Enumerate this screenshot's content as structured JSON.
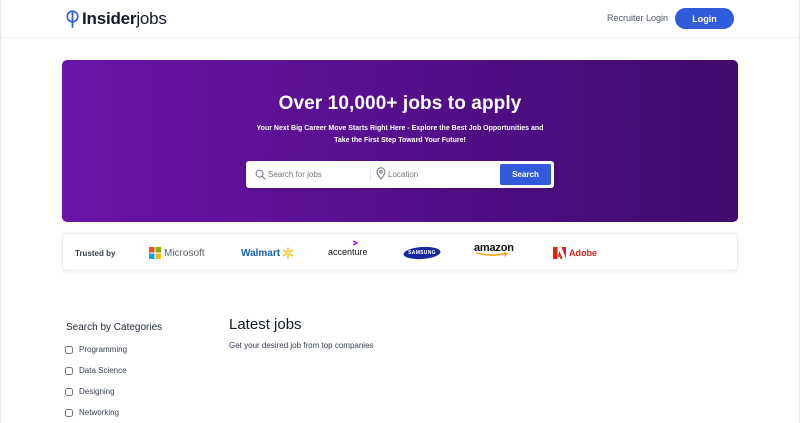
{
  "header": {
    "logo_prefix": "Insider",
    "logo_suffix": "jobs",
    "recruiter_login": "Recruiter Login",
    "login": "Login"
  },
  "hero": {
    "title": "Over 10,000+ jobs to apply",
    "subtitle_line1": "Your Next Big Career Move Starts Right Here - Explore the Best Job Opportunities and",
    "subtitle_line2": "Take the First Step Toward Your Future!",
    "search_placeholder": "Search for jobs",
    "location_placeholder": "Location",
    "search_button": "Search"
  },
  "trusted": {
    "label": "Trusted by",
    "brands": [
      "Microsoft",
      "Walmart",
      "accenture",
      "SAMSUNG",
      "amazon",
      "Adobe"
    ]
  },
  "filters": {
    "title": "Search by Categories",
    "categories": [
      "Programming",
      "Data Science",
      "Designing",
      "Networking"
    ]
  },
  "jobs": {
    "title": "Latest jobs",
    "subtitle": "Get your desired job from top companies"
  },
  "colors": {
    "primary": "#2f5bdc",
    "hero_start": "#6a14a8",
    "hero_end": "#3f0a6d"
  }
}
